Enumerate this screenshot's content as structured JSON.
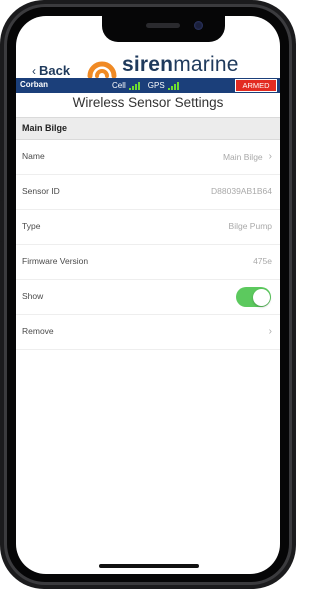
{
  "header": {
    "back_label": "Back",
    "logo_bold": "siren",
    "logo_regular": "marine"
  },
  "statusbar": {
    "boat_name": "Corban",
    "cell_label": "Cell",
    "gps_label": "GPS",
    "armed_label": "ARMED",
    "signal_color": "#6fdc2e",
    "armed_color": "#e32b22"
  },
  "page": {
    "title": "Wireless Sensor Settings",
    "section": "Main Bilge"
  },
  "rows": {
    "name": {
      "label": "Name",
      "value": "Main Bilge"
    },
    "sensor_id": {
      "label": "Sensor ID",
      "value": "D88039AB1B64"
    },
    "type": {
      "label": "Type",
      "value": "Bilge Pump"
    },
    "firmware": {
      "label": "Firmware Version",
      "value": "475e"
    },
    "show": {
      "label": "Show",
      "value": "on"
    },
    "remove": {
      "label": "Remove"
    }
  },
  "icons": {
    "back": "chevron-left-icon",
    "logo": "siren-marine-logo-icon",
    "cell_signal": "signal-bars-icon",
    "gps_signal": "signal-bars-icon",
    "row_arrow": "chevron-right-icon"
  }
}
